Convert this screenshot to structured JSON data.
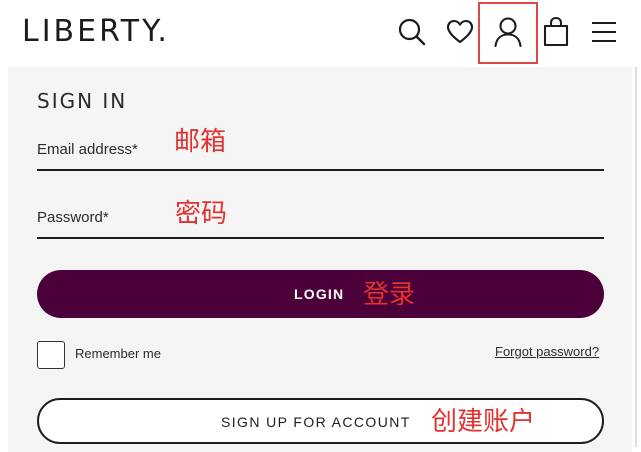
{
  "header": {
    "logo": "LIBERTY.",
    "icons": [
      "search-icon",
      "heart-icon",
      "account-icon",
      "shopping-bag-icon",
      "menu-icon"
    ]
  },
  "signin": {
    "title": "SIGN IN",
    "email_label": "Email address*",
    "email_value": "",
    "password_label": "Password*",
    "password_value": "",
    "login_label": "LOGIN",
    "remember_label": "Remember me",
    "remember_checked": false,
    "forgot_label": "Forgot password?",
    "signup_label": "SIGN UP FOR ACCOUNT"
  },
  "annotations": {
    "email": "邮箱",
    "password": "密码",
    "login": "登录",
    "signup": "创建账户"
  },
  "colors": {
    "brand_purple": "#4b003a",
    "annotation_red": "#e2312f",
    "highlight_box": "#e04848"
  }
}
